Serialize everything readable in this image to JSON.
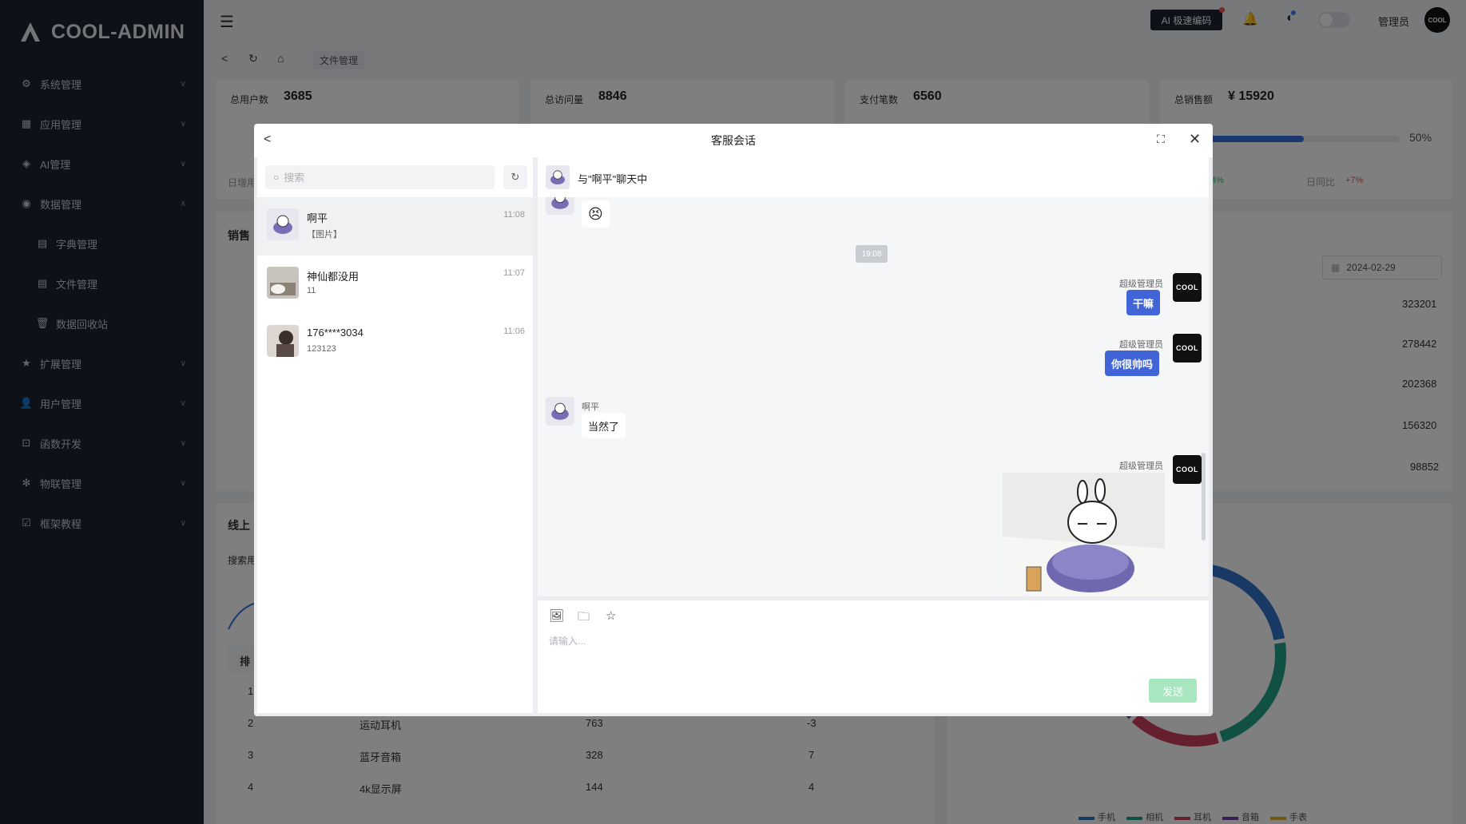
{
  "app": {
    "logo_text": "COOL-ADMIN"
  },
  "sidebar": {
    "items": [
      {
        "label": "系统管理",
        "icon": "gear-icon"
      },
      {
        "label": "应用管理",
        "icon": "grid-icon"
      },
      {
        "label": "AI管理",
        "icon": "cube-icon"
      },
      {
        "label": "数据管理",
        "icon": "check-circle-icon"
      },
      {
        "label": "字典管理",
        "icon": "doc-icon"
      },
      {
        "label": "文件管理",
        "icon": "doc-icon"
      },
      {
        "label": "数据回收站",
        "icon": "trash-icon"
      },
      {
        "label": "扩展管理",
        "icon": "star-icon"
      },
      {
        "label": "用户管理",
        "icon": "user-icon"
      },
      {
        "label": "函数开发",
        "icon": "function-icon"
      },
      {
        "label": "物联管理",
        "icon": "asterisk-icon"
      },
      {
        "label": "框架教程",
        "icon": "check-square-icon"
      }
    ]
  },
  "header": {
    "ai_button": "AI 极速编码",
    "username": "管理员",
    "avatar_text": "COOL"
  },
  "breadcrumb": {
    "current": "文件管理"
  },
  "dashboard": {
    "stats": [
      {
        "title": "总用户数",
        "value": "3685"
      },
      {
        "title": "总访问量",
        "value": "8846"
      },
      {
        "title": "支付笔数",
        "value": "6560"
      },
      {
        "title": "总销售额",
        "value": "¥ 15920"
      }
    ],
    "progress_label": "50%",
    "progress_value": 0.5,
    "row_labels": {
      "new_users": "日增用",
      "day_compare": "日同比",
      "day_compare_val": "+7%",
      "week_val": "4%"
    },
    "sales_title": "销售",
    "online_title": "线上",
    "search_label": "搜索用",
    "date_value": "2024-02-29",
    "ranking_values": [
      "323201",
      "278442",
      "202368",
      "156320",
      "98852"
    ],
    "rank_header": "排",
    "table_rows": [
      {
        "rank": "1",
        "name": "",
        "count": "",
        "change": ""
      },
      {
        "rank": "2",
        "name": "运动耳机",
        "count": "763",
        "change": "-3"
      },
      {
        "rank": "3",
        "name": "蓝牙音箱",
        "count": "328",
        "change": "7"
      },
      {
        "rank": "4",
        "name": "4k显示屏",
        "count": "144",
        "change": "4"
      }
    ],
    "legend": [
      "手机",
      "相机",
      "耳机",
      "音箱",
      "手表"
    ]
  },
  "dialog": {
    "title": "客服会话",
    "search_placeholder": "搜索",
    "conversations": [
      {
        "name": "啊平",
        "last_message": "【图片】",
        "time": "11:08"
      },
      {
        "name": "神仙都没用",
        "last_message": "11",
        "time": "11:07"
      },
      {
        "name": "176****3034",
        "last_message": "123123",
        "time": "11:06"
      }
    ],
    "chat_title": "与\"啊平\"聊天中",
    "messages": {
      "emoji": "😣",
      "time_divider": "19:08",
      "admin_name": "超级管理员",
      "admin_avatar": "COOL",
      "msg1": "干嘛",
      "msg2": "你很帅吗",
      "user_name": "啊平",
      "msg3": "当然了"
    },
    "input_placeholder": "请输入...",
    "send_label": "发送"
  }
}
